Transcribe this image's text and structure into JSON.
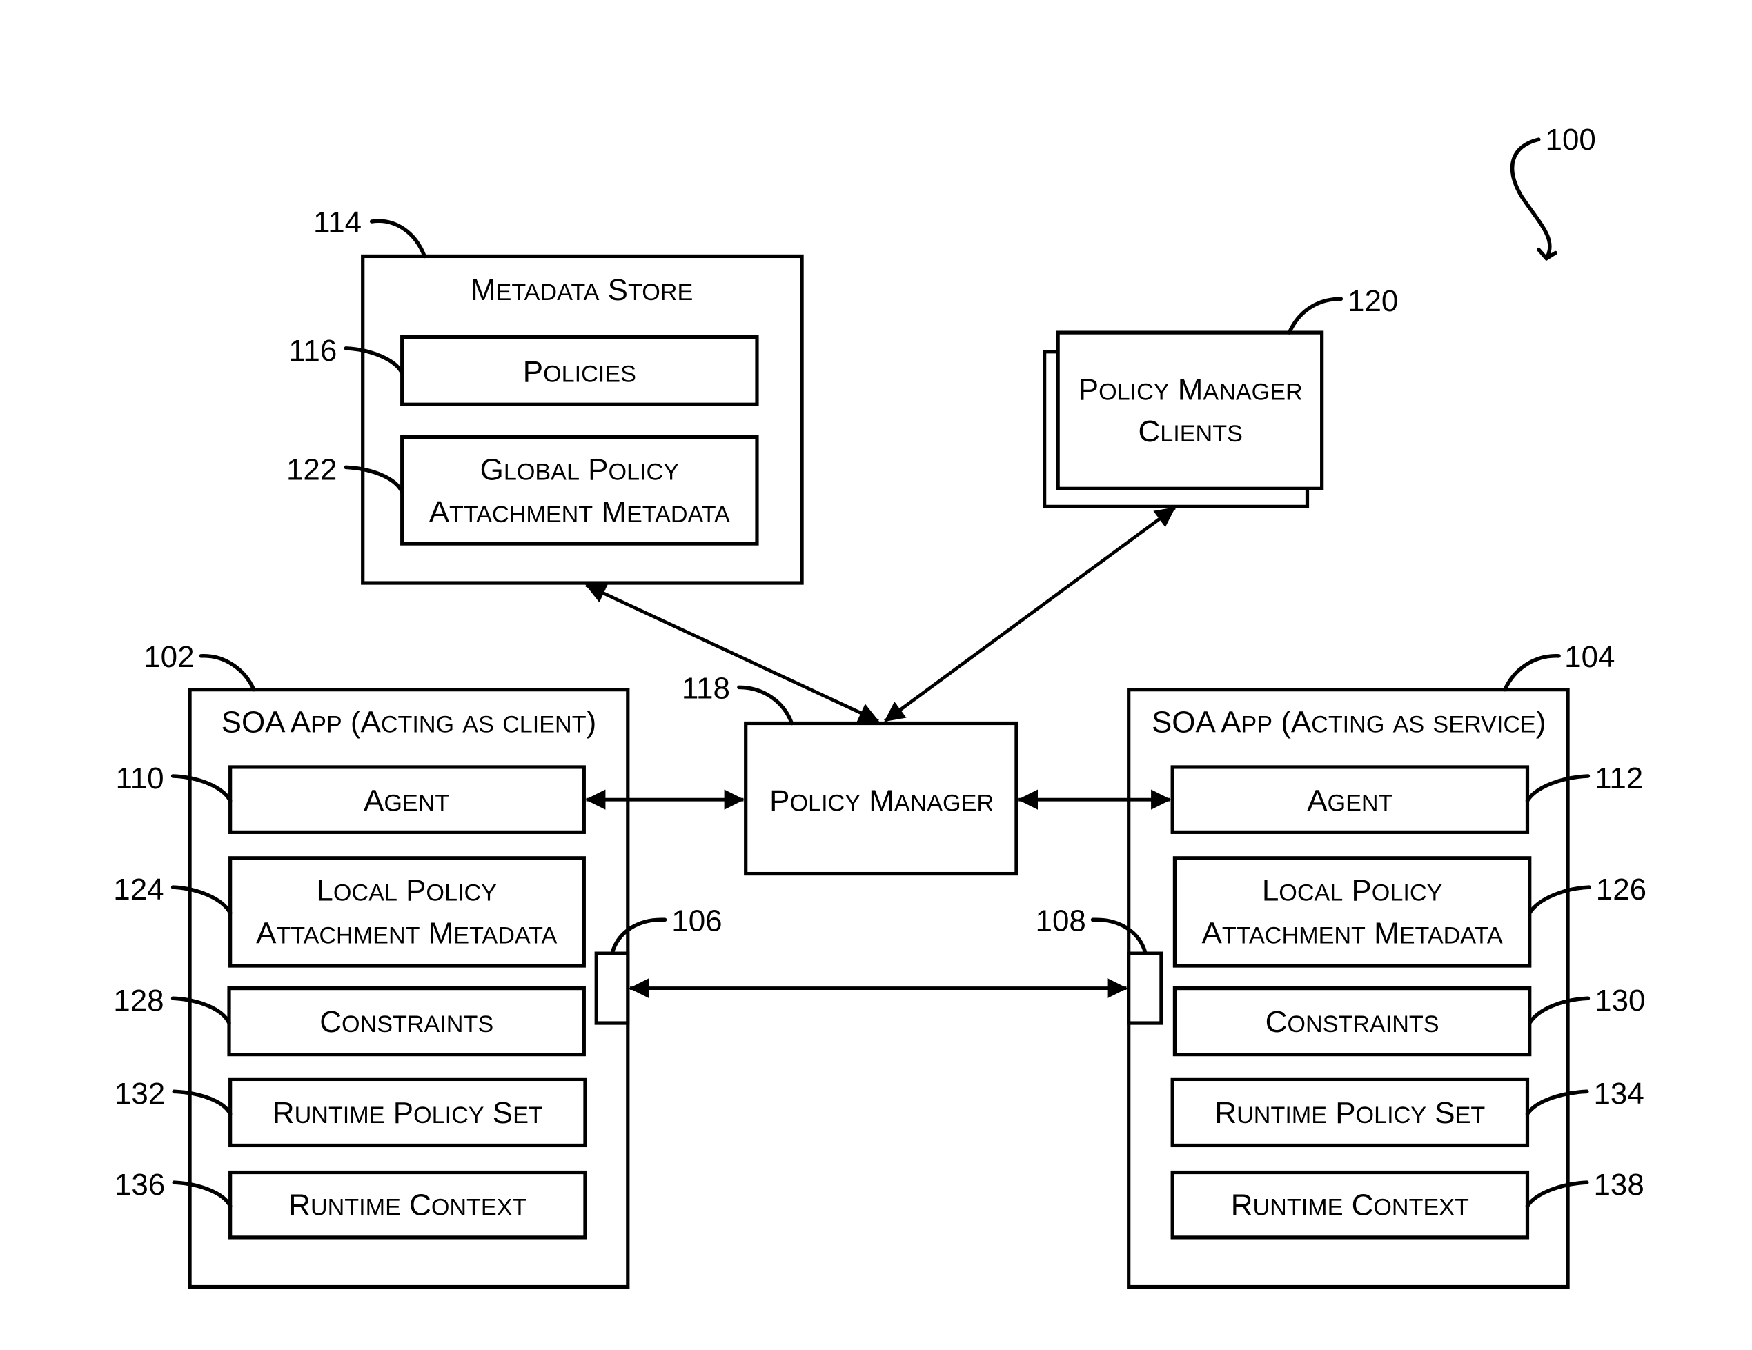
{
  "figure": {
    "ref": "100",
    "metadata_store": {
      "ref": "114",
      "title": "Metadata Store",
      "policies": {
        "ref": "116",
        "label": "Policies"
      },
      "global_policy_attachment": {
        "ref": "122",
        "lines": [
          "Global Policy",
          "Attachment Metadata"
        ]
      }
    },
    "policy_manager_clients": {
      "ref": "120",
      "lines": [
        "Policy Manager",
        "Clients"
      ]
    },
    "policy_manager": {
      "ref": "118",
      "label": "Policy Manager"
    },
    "client_app": {
      "ref": "102",
      "title": "SOA App (Acting as client)",
      "port_ref": "106",
      "agent": {
        "ref": "110",
        "label": "Agent"
      },
      "local_policy_attachment": {
        "ref": "124",
        "lines": [
          "Local Policy",
          "Attachment Metadata"
        ]
      },
      "constraints": {
        "ref": "128",
        "label": "Constraints"
      },
      "runtime_policy_set": {
        "ref": "132",
        "label": "Runtime Policy Set"
      },
      "runtime_context": {
        "ref": "136",
        "label": "Runtime Context"
      }
    },
    "service_app": {
      "ref": "104",
      "title": "SOA App (Acting as service)",
      "port_ref": "108",
      "agent": {
        "ref": "112",
        "label": "Agent"
      },
      "local_policy_attachment": {
        "ref": "126",
        "lines": [
          "Local Policy",
          "Attachment Metadata"
        ]
      },
      "constraints": {
        "ref": "130",
        "label": "Constraints"
      },
      "runtime_policy_set": {
        "ref": "134",
        "label": "Runtime Policy Set"
      },
      "runtime_context": {
        "ref": "138",
        "label": "Runtime Context"
      }
    },
    "connections": [
      {
        "from": "Metadata Store",
        "to": "Policy Manager",
        "direction": "bidirectional"
      },
      {
        "from": "Policy Manager Clients",
        "to": "Policy Manager",
        "direction": "bidirectional"
      },
      {
        "from": "Agent (client)",
        "to": "Policy Manager",
        "direction": "bidirectional"
      },
      {
        "from": "Policy Manager",
        "to": "Agent (service)",
        "direction": "bidirectional"
      },
      {
        "from": "Port 106",
        "to": "Port 108",
        "direction": "bidirectional"
      }
    ]
  }
}
